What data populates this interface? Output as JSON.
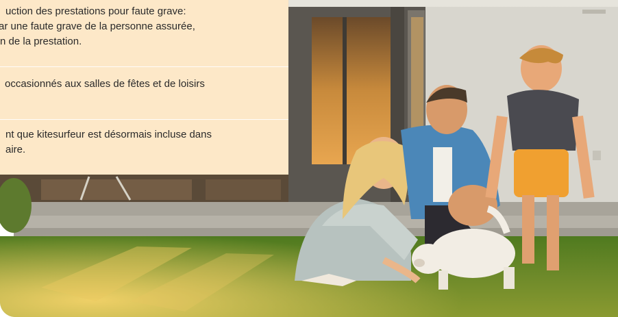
{
  "panel": {
    "items": [
      {
        "lines": [
          "uction des prestations pour faute grave:",
          "ar une faute grave de la personne assurée,",
          "n de la prestation."
        ]
      },
      {
        "lines": [
          "occasionnés aux salles de fêtes et de loisirs",
          ""
        ]
      },
      {
        "lines": [
          "nt que kitesurfeur est désormais incluse dans",
          "aire."
        ]
      }
    ]
  },
  "photo": {
    "description_icon": "family-playing-with-puppy-photo"
  },
  "colors": {
    "panel_bg": "#fde8c8",
    "grass": "#6e8a2a",
    "house_wall": "#d9d6cc"
  }
}
